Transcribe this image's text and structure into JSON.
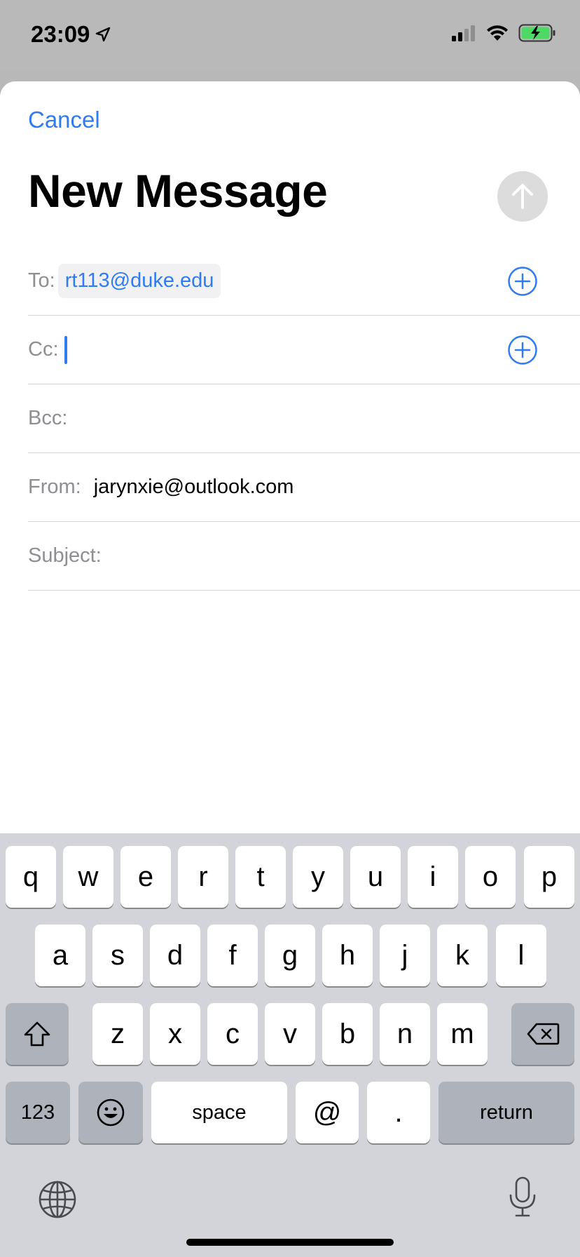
{
  "status": {
    "time": "23:09",
    "icons": [
      "location-arrow-icon",
      "signal-icon",
      "wifi-icon",
      "battery-charging-icon"
    ],
    "battery_color": "#4cd964"
  },
  "compose": {
    "cancel_label": "Cancel",
    "title": "New Message",
    "send_icon": "arrow-up-icon",
    "to_label": "To:",
    "to_recipient": "rt113@duke.edu",
    "cc_label": "Cc:",
    "bcc_label": "Bcc:",
    "from_label": "From:",
    "from_value": "jarynxie@outlook.com",
    "subject_label": "Subject:",
    "accent_color": "#2f7bf0"
  },
  "keyboard": {
    "row1": [
      "q",
      "w",
      "e",
      "r",
      "t",
      "y",
      "u",
      "i",
      "o",
      "p"
    ],
    "row2": [
      "a",
      "s",
      "d",
      "f",
      "g",
      "h",
      "j",
      "k",
      "l"
    ],
    "row3": [
      "z",
      "x",
      "c",
      "v",
      "b",
      "n",
      "m"
    ],
    "numbers_label": "123",
    "space_label": "space",
    "at_label": "@",
    "period_label": ".",
    "return_label": "return"
  }
}
